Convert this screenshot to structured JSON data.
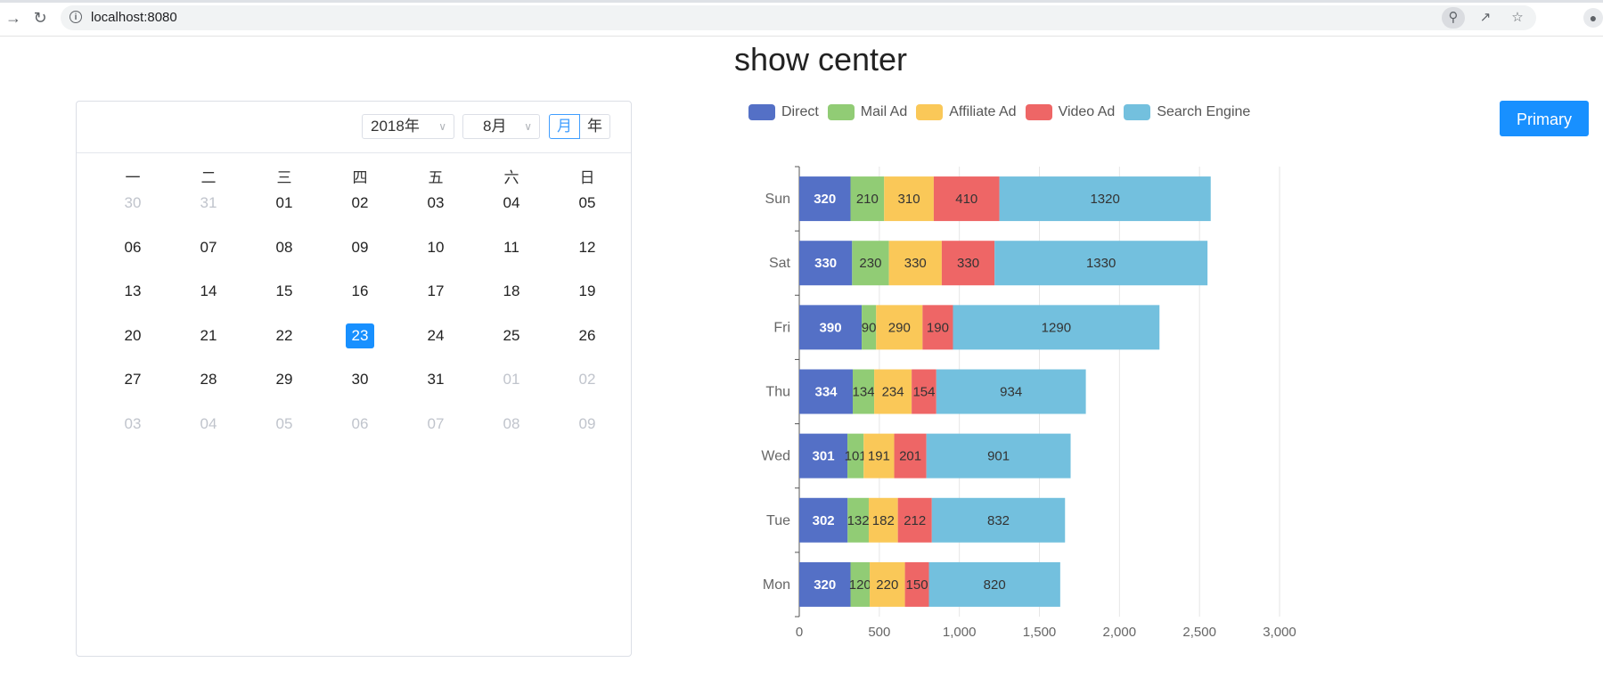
{
  "browser": {
    "url": "localhost:8080",
    "icons": [
      "back-arrow-icon",
      "reload-icon",
      "info-icon",
      "zoom-icon",
      "share-icon",
      "star-icon",
      "profile-icon"
    ]
  },
  "page": {
    "title": "show center"
  },
  "calendar": {
    "year_label": "2018年",
    "month_label": "8月",
    "mode_month": "月",
    "mode_year": "年",
    "weekdays": [
      "一",
      "二",
      "三",
      "四",
      "五",
      "六",
      "日"
    ],
    "weeks": [
      [
        {
          "d": "30",
          "m": true
        },
        {
          "d": "31",
          "m": true
        },
        {
          "d": "01"
        },
        {
          "d": "02"
        },
        {
          "d": "03"
        },
        {
          "d": "04"
        },
        {
          "d": "05"
        }
      ],
      [
        {
          "d": "06"
        },
        {
          "d": "07"
        },
        {
          "d": "08"
        },
        {
          "d": "09"
        },
        {
          "d": "10"
        },
        {
          "d": "11"
        },
        {
          "d": "12"
        }
      ],
      [
        {
          "d": "13"
        },
        {
          "d": "14"
        },
        {
          "d": "15"
        },
        {
          "d": "16"
        },
        {
          "d": "17"
        },
        {
          "d": "18"
        },
        {
          "d": "19"
        }
      ],
      [
        {
          "d": "20"
        },
        {
          "d": "21"
        },
        {
          "d": "22"
        },
        {
          "d": "23",
          "t": true
        },
        {
          "d": "24"
        },
        {
          "d": "25"
        },
        {
          "d": "26"
        }
      ],
      [
        {
          "d": "27"
        },
        {
          "d": "28"
        },
        {
          "d": "29"
        },
        {
          "d": "30"
        },
        {
          "d": "31"
        },
        {
          "d": "01",
          "m": true
        },
        {
          "d": "02",
          "m": true
        }
      ],
      [
        {
          "d": "03",
          "m": true
        },
        {
          "d": "04",
          "m": true
        },
        {
          "d": "05",
          "m": true
        },
        {
          "d": "06",
          "m": true
        },
        {
          "d": "07",
          "m": true
        },
        {
          "d": "08",
          "m": true
        },
        {
          "d": "09",
          "m": true
        }
      ]
    ]
  },
  "primary_button": {
    "label": "Primary",
    "color": "#1890ff"
  },
  "chart_data": {
    "type": "bar",
    "orientation": "horizontal",
    "stacked": true,
    "categories": [
      "Mon",
      "Tue",
      "Wed",
      "Thu",
      "Fri",
      "Sat",
      "Sun"
    ],
    "series": [
      {
        "name": "Direct",
        "color": "#5470c6",
        "values": [
          320,
          302,
          301,
          334,
          390,
          330,
          320
        ]
      },
      {
        "name": "Mail Ad",
        "color": "#91cc75",
        "values": [
          120,
          132,
          101,
          134,
          90,
          230,
          210
        ]
      },
      {
        "name": "Affiliate Ad",
        "color": "#fac858",
        "values": [
          220,
          182,
          191,
          234,
          290,
          330,
          310
        ]
      },
      {
        "name": "Video Ad",
        "color": "#ee6666",
        "values": [
          150,
          212,
          201,
          154,
          190,
          330,
          410
        ]
      },
      {
        "name": "Search Engine",
        "color": "#73c0de",
        "values": [
          820,
          832,
          901,
          934,
          1290,
          1330,
          1320
        ]
      }
    ],
    "xlim": [
      0,
      3000
    ],
    "x_ticks": [
      "0",
      "500",
      "1,000",
      "1,500",
      "2,000",
      "2,500",
      "3,000"
    ],
    "grid": true,
    "legend_position": "top",
    "data_labels": true
  }
}
